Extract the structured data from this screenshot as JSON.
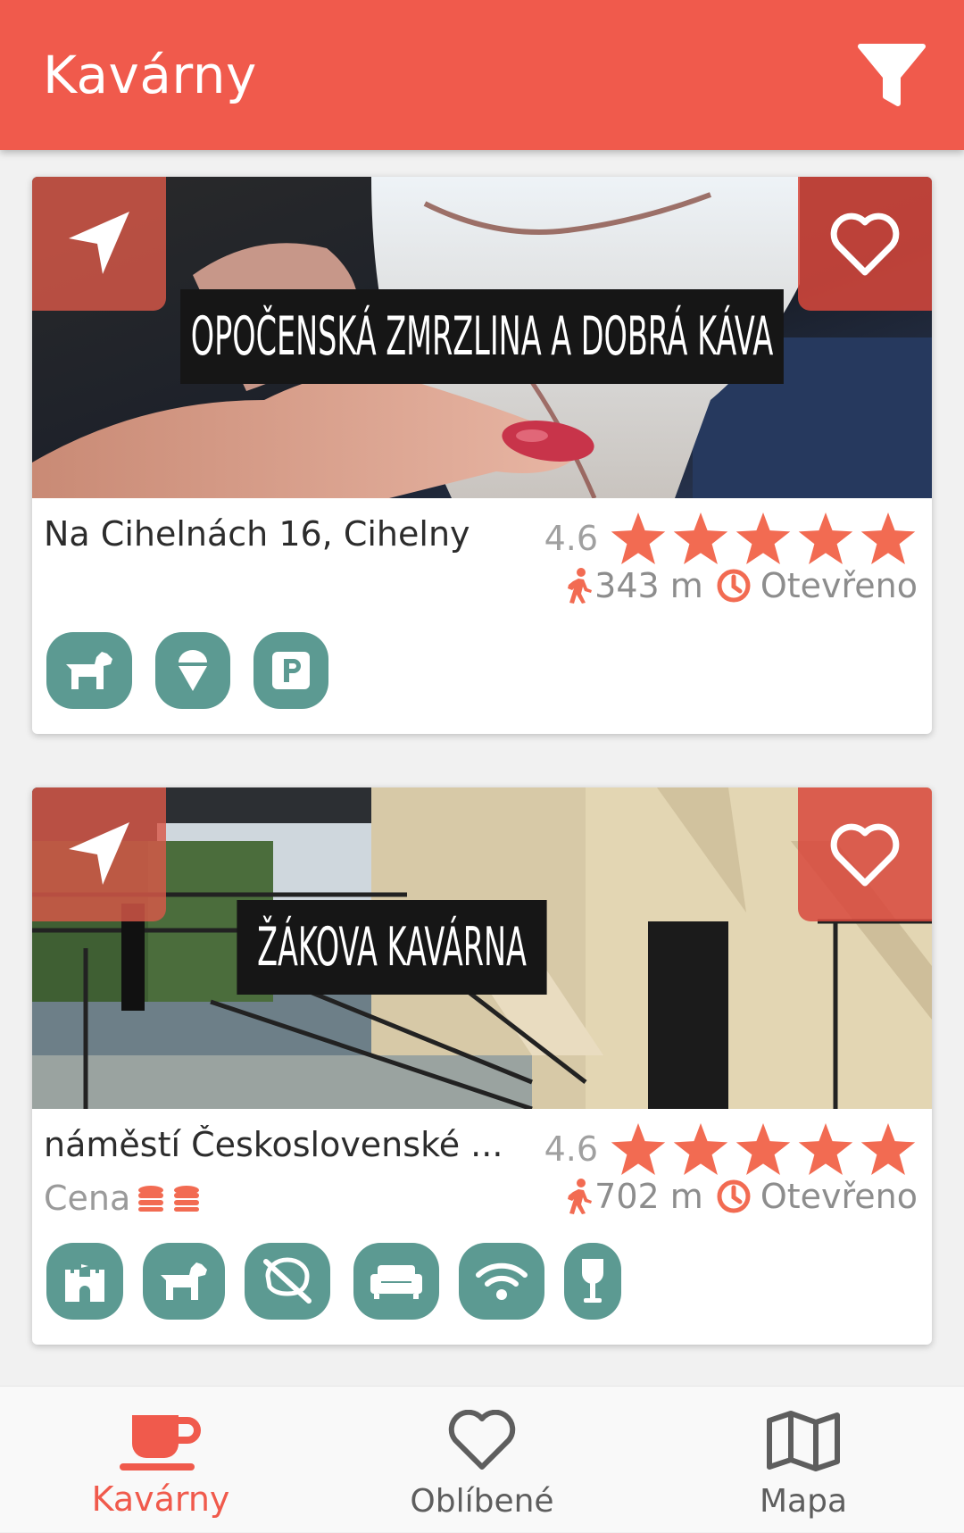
{
  "app_bar": {
    "title": "Kavárny"
  },
  "cards": [
    {
      "name": "Opočenská zmrzlina a dobrá káva",
      "address": "Na Cihelnách 16, Cihelny",
      "rating": "4.6",
      "stars": 5,
      "distance": "343 m",
      "status": "Otevřeno",
      "amenities": [
        "dog-friendly-icon",
        "ice-cream-icon",
        "parking-icon"
      ]
    },
    {
      "name": "Žákova kavárna",
      "address": "náměstí Československé ...",
      "price_label": "Cena",
      "rating": "4.6",
      "stars": 5,
      "distance": "702 m",
      "status": "Otevřeno",
      "amenities": [
        "castle-icon",
        "dog-friendly-icon",
        "no-smoking-icon",
        "sofa-icon",
        "wifi-icon",
        "wine-icon"
      ]
    }
  ],
  "bottom_nav": {
    "tabs": [
      {
        "label": "Kavárny",
        "icon": "coffee-cup-icon",
        "active": true
      },
      {
        "label": "Oblíbené",
        "icon": "heart-icon",
        "active": false
      },
      {
        "label": "Mapa",
        "icon": "map-icon",
        "active": false
      }
    ]
  },
  "colors": {
    "primary": "#f05a4c",
    "amenity": "#5c9a92",
    "star": "#f26b52"
  }
}
